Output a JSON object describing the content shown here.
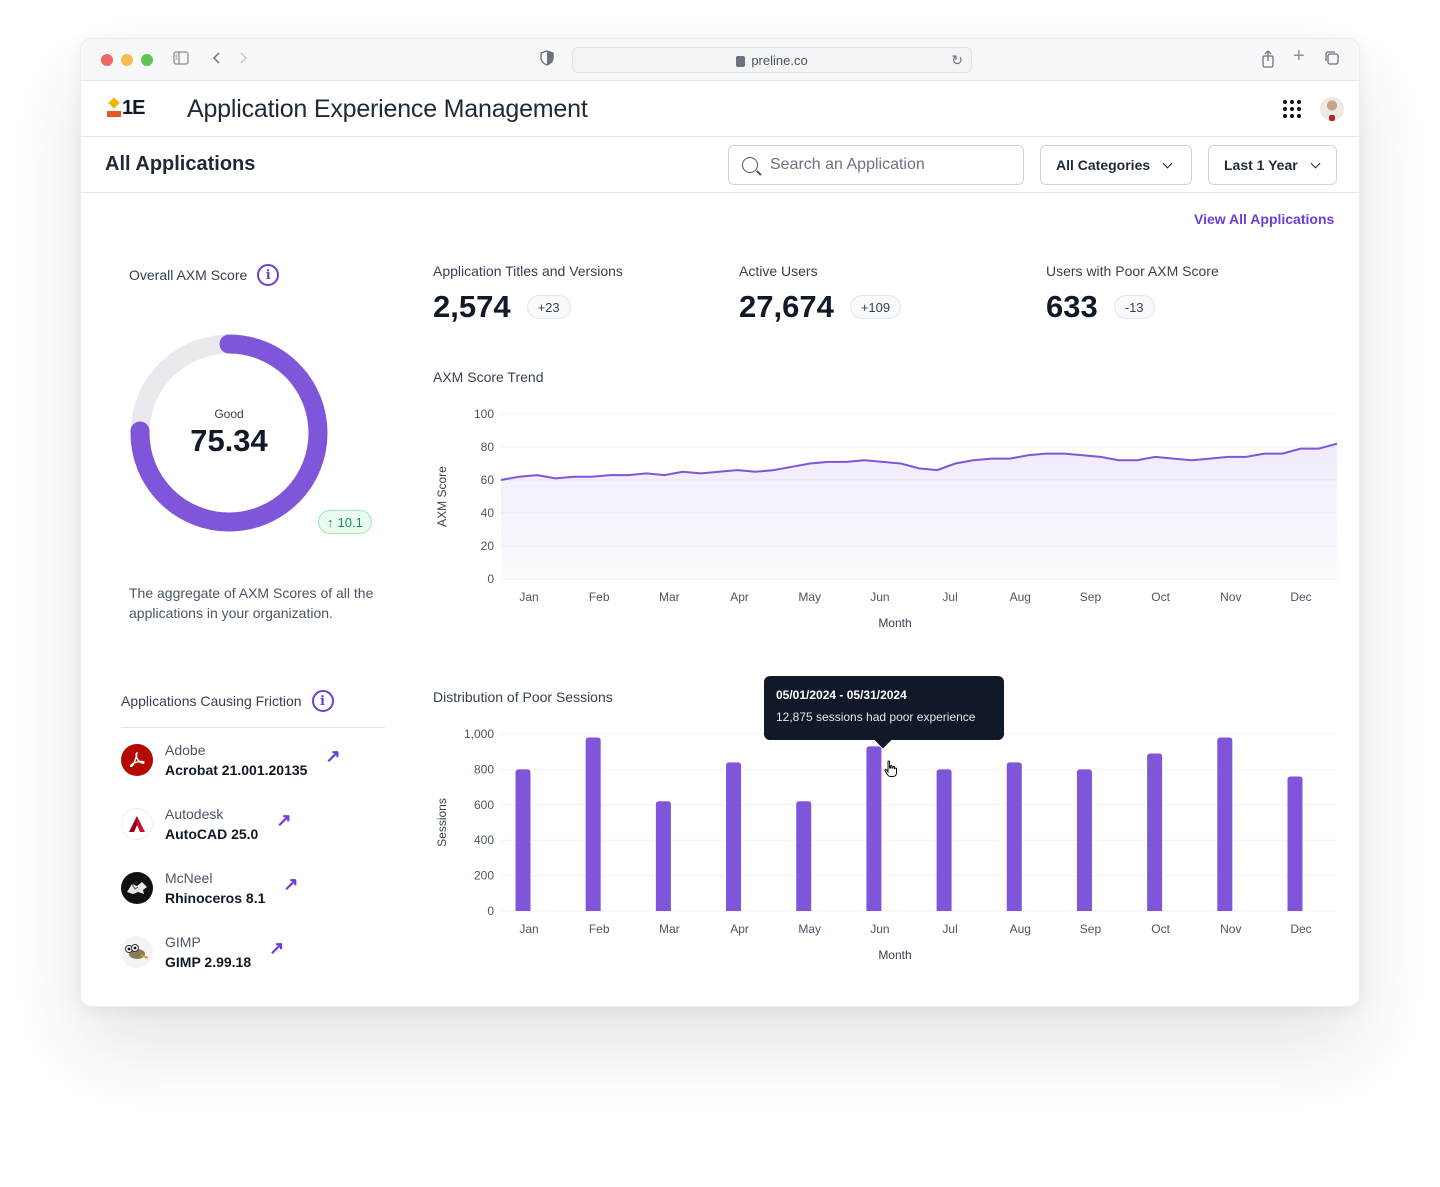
{
  "browser": {
    "url": "preline.co"
  },
  "app": {
    "logo_text": "1E",
    "title": "Application Experience Management"
  },
  "toolbar": {
    "page_title": "All Applications",
    "search_placeholder": "Search an Application",
    "category_select": "All Categories",
    "period_select": "Last 1 Year",
    "view_all_link": "View All Applications"
  },
  "overall_score": {
    "label": "Overall AXM Score",
    "status": "Good",
    "value": "75.34",
    "value_percent": 75.34,
    "delta": "10.1",
    "delta_direction": "up",
    "description": "The aggregate of AXM Scores of all the applications in your organization."
  },
  "kpis": [
    {
      "label": "Application Titles and Versions",
      "value": "2,574",
      "delta": "+23"
    },
    {
      "label": "Active Users",
      "value": "27,674",
      "delta": "+109"
    },
    {
      "label": "Users with Poor AXM Score",
      "value": "633",
      "delta": "-13"
    }
  ],
  "colors": {
    "accent": "#7f56d9",
    "link": "#6d3ed6",
    "track": "#e9eaee",
    "success": "#16924a",
    "tooltip_bg": "#111827"
  },
  "friction": {
    "label": "Applications Causing Friction",
    "items": [
      {
        "vendor": "Adobe",
        "name": "Acrobat 21.001.20135",
        "icon": "adobe-acrobat-icon"
      },
      {
        "vendor": "Autodesk",
        "name": "AutoCAD 25.0",
        "icon": "autocad-icon"
      },
      {
        "vendor": "McNeel",
        "name": "Rhinoceros 8.1",
        "icon": "rhinoceros-icon"
      },
      {
        "vendor": "GIMP",
        "name": "GIMP 2.99.18",
        "icon": "gimp-icon"
      }
    ]
  },
  "tooltip": {
    "title": "05/01/2024 - 05/31/2024",
    "body": "12,875 sessions had poor experience"
  },
  "chart_data": [
    {
      "type": "area",
      "title": "AXM Score Trend",
      "xlabel": "Month",
      "ylabel": "AXM Score",
      "ylim": [
        0,
        100
      ],
      "yticks": [
        0,
        20,
        40,
        60,
        80,
        100
      ],
      "categories": [
        "Jan",
        "Feb",
        "Mar",
        "Apr",
        "May",
        "Jun",
        "Jul",
        "Aug",
        "Sep",
        "Oct",
        "Nov",
        "Dec"
      ],
      "grid": true,
      "series": [
        {
          "name": "AXM Score",
          "values": [
            60,
            62,
            63,
            61,
            62,
            62,
            63,
            63,
            64,
            63,
            65,
            64,
            65,
            66,
            65,
            66,
            68,
            70,
            71,
            71,
            72,
            71,
            70,
            67,
            66,
            70,
            72,
            73,
            73,
            75,
            76,
            76,
            75,
            74,
            72,
            72,
            74,
            73,
            72,
            73,
            74,
            74,
            76,
            76,
            79,
            79,
            82
          ]
        }
      ]
    },
    {
      "type": "bar",
      "title": "Distribution of Poor Sessions",
      "xlabel": "Month",
      "ylabel": "Sessions",
      "ylim": [
        0,
        1000
      ],
      "yticks": [
        0,
        200,
        400,
        600,
        800,
        1000
      ],
      "ytick_labels": [
        "0",
        "200",
        "400",
        "600",
        "800",
        "1,000"
      ],
      "categories": [
        "Jan",
        "Feb",
        "Mar",
        "Apr",
        "May",
        "Jun",
        "Jul",
        "Aug",
        "Sep",
        "Oct",
        "Nov",
        "Dec"
      ],
      "grid": true,
      "series": [
        {
          "name": "Sessions",
          "values": [
            800,
            980,
            620,
            840,
            620,
            930,
            800,
            840,
            800,
            890,
            980,
            760
          ]
        }
      ]
    }
  ]
}
